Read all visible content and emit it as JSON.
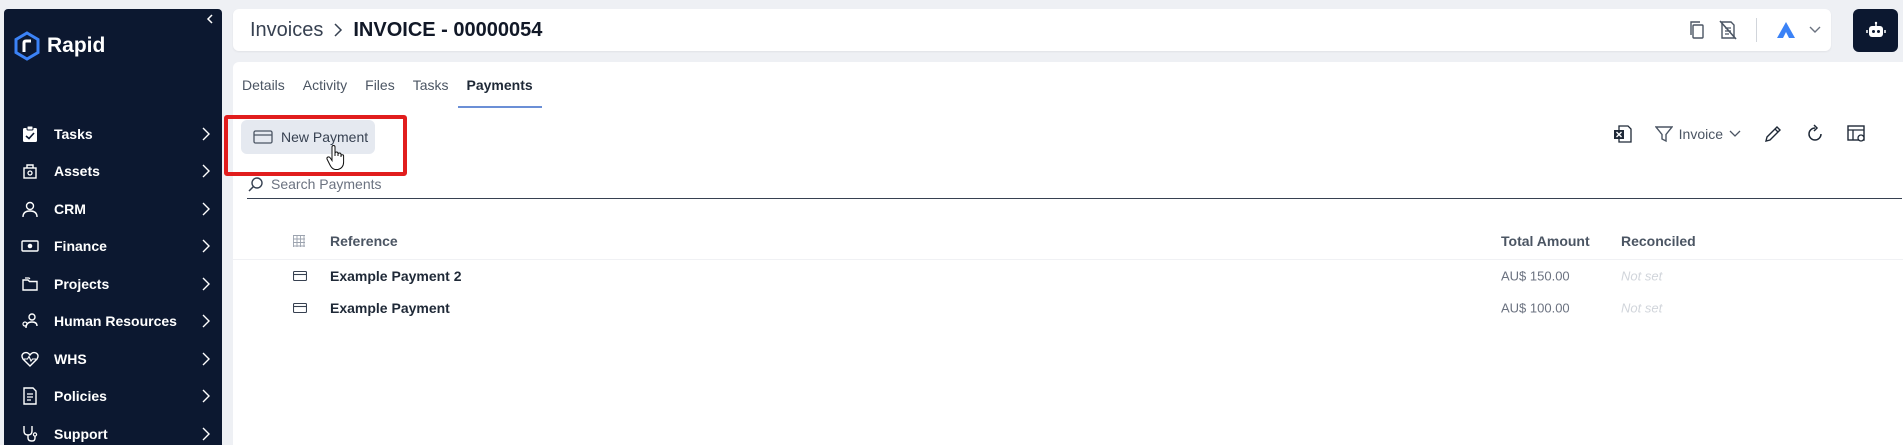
{
  "app": {
    "name": "Rapid"
  },
  "sidebar": {
    "items": [
      {
        "label": "Tasks",
        "icon": "clipboard-icon"
      },
      {
        "label": "Assets",
        "icon": "assets-icon"
      },
      {
        "label": "CRM",
        "icon": "person-icon"
      },
      {
        "label": "Finance",
        "icon": "banknote-icon"
      },
      {
        "label": "Projects",
        "icon": "folders-icon"
      },
      {
        "label": "Human Resources",
        "icon": "people-icon"
      },
      {
        "label": "WHS",
        "icon": "heart-pulse-icon"
      },
      {
        "label": "Policies",
        "icon": "document-icon"
      },
      {
        "label": "Support",
        "icon": "stethoscope-icon"
      }
    ]
  },
  "header": {
    "breadcrumb_parent": "Invoices",
    "breadcrumb_separator": ">",
    "title": "INVOICE - 00000054"
  },
  "tabs": [
    "Details",
    "Activity",
    "Files",
    "Tasks",
    "Payments"
  ],
  "active_tab": "Payments",
  "toolbar": {
    "new_payment_label": "New Payment",
    "filter_label": "Invoice"
  },
  "search": {
    "placeholder": "Search Payments"
  },
  "table": {
    "columns": {
      "reference": "Reference",
      "total_amount": "Total Amount",
      "reconciled": "Reconciled"
    },
    "rows": [
      {
        "reference": "Example Payment 2",
        "total_amount": "AU$ 150.00",
        "reconciled": "Not set"
      },
      {
        "reference": "Example Payment",
        "total_amount": "AU$ 100.00",
        "reconciled": "Not set"
      }
    ]
  },
  "colors": {
    "sidebar_bg": "#0c1830",
    "accent": "#6b8fd6",
    "highlight": "#e11d1d",
    "brand_blue": "#3b82f6"
  }
}
